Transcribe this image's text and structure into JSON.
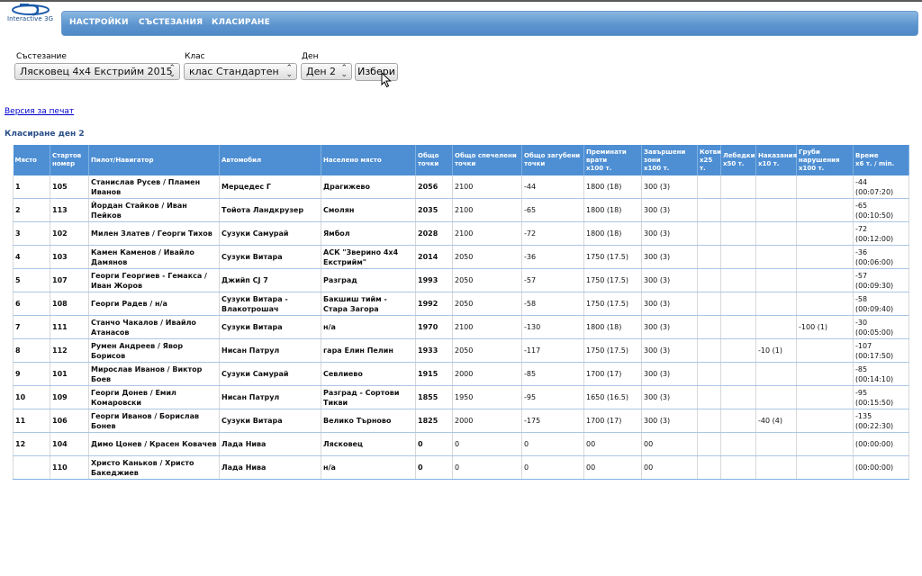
{
  "logo": {
    "text": "Interactive 3G"
  },
  "nav": {
    "items": [
      "НАСТРОЙКИ",
      "СЪСТЕЗАНИЯ",
      "КЛАСИРАНЕ"
    ]
  },
  "filters": {
    "competition_label": "Състезание",
    "competition_value": "Лясковец 4х4 Екстрийм 2015",
    "class_label": "Клас",
    "class_value": "клас Стандартен",
    "day_label": "Ден",
    "day_value": "Ден 2",
    "select_button": "Избери"
  },
  "print_link": "Версия за печат",
  "section_title": "Класиране ден 2",
  "table": {
    "headers": [
      [
        "Място"
      ],
      [
        "Стартов",
        "номер"
      ],
      [
        "Пилот/Навигатор"
      ],
      [
        "Автомобил"
      ],
      [
        "Населено място"
      ],
      [
        "Общо",
        "точки"
      ],
      [
        "Общо спечелени",
        "точки"
      ],
      [
        "Общо загубени",
        "точки"
      ],
      [
        "Преминати",
        "врати",
        "x100 т."
      ],
      [
        "Завършени",
        "зони",
        "x100 т."
      ],
      [
        "Котви",
        "x25 т."
      ],
      [
        "Лебедки",
        "x50 т."
      ],
      [
        "Наказания",
        "x10 т."
      ],
      [
        "Груби",
        "нарушения",
        "x100 т."
      ],
      [
        "Време",
        "x6 т. / min."
      ]
    ],
    "rows": [
      [
        "1",
        "105",
        "Станислав Русев / Пламен Иванов",
        "Мерцедес Г",
        "Драгижево",
        "2056",
        "2100",
        "-44",
        "1800 (18)",
        "300 (3)",
        "",
        "",
        "",
        "",
        "-44 (00:07:20)"
      ],
      [
        "2",
        "113",
        "Йордан Стайков / Иван Пейков",
        "Тойота Ландкрузер",
        "Смолян",
        "2035",
        "2100",
        "-65",
        "1800 (18)",
        "300 (3)",
        "",
        "",
        "",
        "",
        "-65 (00:10:50)"
      ],
      [
        "3",
        "102",
        "Милен Златев / Георги Тихов",
        "Сузуки Самурай",
        "Ямбол",
        "2028",
        "2100",
        "-72",
        "1800 (18)",
        "300 (3)",
        "",
        "",
        "",
        "",
        "-72 (00:12:00)"
      ],
      [
        "4",
        "103",
        "Камен Каменов / Ивайло Дамянов",
        "Сузуки Витара",
        "АСК \"Зверино 4х4 Екстрийм\"",
        "2014",
        "2050",
        "-36",
        "1750 (17.5)",
        "300 (3)",
        "",
        "",
        "",
        "",
        "-36 (00:06:00)"
      ],
      [
        "5",
        "107",
        "Георги Георгиев - Гемакса / Иван Жоров",
        "Джийп CJ 7",
        "Разград",
        "1993",
        "2050",
        "-57",
        "1750 (17.5)",
        "300 (3)",
        "",
        "",
        "",
        "",
        "-57 (00:09:30)"
      ],
      [
        "6",
        "108",
        "Георги Радев / н/а",
        "Сузуки Витара - Влакотрошач",
        "Бакшиш тийм - Стара Загора",
        "1992",
        "2050",
        "-58",
        "1750 (17.5)",
        "300 (3)",
        "",
        "",
        "",
        "",
        "-58 (00:09:40)"
      ],
      [
        "7",
        "111",
        "Станчо Чакалов / Ивайло Атанасов",
        "Сузуки Витара",
        "н/а",
        "1970",
        "2100",
        "-130",
        "1800 (18)",
        "300 (3)",
        "",
        "",
        "",
        "-100 (1)",
        "-30 (00:05:00)"
      ],
      [
        "8",
        "112",
        "Румен Андреев / Явор Борисов",
        "Нисан Патрул",
        "гара Елин Пелин",
        "1933",
        "2050",
        "-117",
        "1750 (17.5)",
        "300 (3)",
        "",
        "",
        "-10 (1)",
        "",
        "-107 (00:17:50)"
      ],
      [
        "9",
        "101",
        "Мирослав Иванов / Виктор Боев",
        "Сузуки Самурай",
        "Севлиево",
        "1915",
        "2000",
        "-85",
        "1700 (17)",
        "300 (3)",
        "",
        "",
        "",
        "",
        "-85 (00:14:10)"
      ],
      [
        "10",
        "109",
        "Георги Донев / Емил Комаровски",
        "Нисан Патрул",
        "Разград - Сортови Тикви",
        "1855",
        "1950",
        "-95",
        "1650 (16.5)",
        "300 (3)",
        "",
        "",
        "",
        "",
        "-95 (00:15:50)"
      ],
      [
        "11",
        "106",
        "Георги Иванов / Борислав Бонев",
        "Сузуки Витара",
        "Велико Търново",
        "1825",
        "2000",
        "-175",
        "1700 (17)",
        "300 (3)",
        "",
        "",
        "-40 (4)",
        "",
        "-135 (00:22:30)"
      ],
      [
        "12",
        "104",
        "Димо Цонев / Красен Ковачев",
        "Лада Нива",
        "Лясковец",
        "0",
        "0",
        "0",
        "00",
        "00",
        "",
        "",
        "",
        "",
        "(00:00:00)"
      ],
      [
        "",
        "110",
        "Христо Каньков / Христо Бакеджиев",
        "Лада Нива",
        "н/а",
        "0",
        "0",
        "0",
        "00",
        "00",
        "",
        "",
        "",
        "",
        "(00:00:00)"
      ]
    ]
  }
}
